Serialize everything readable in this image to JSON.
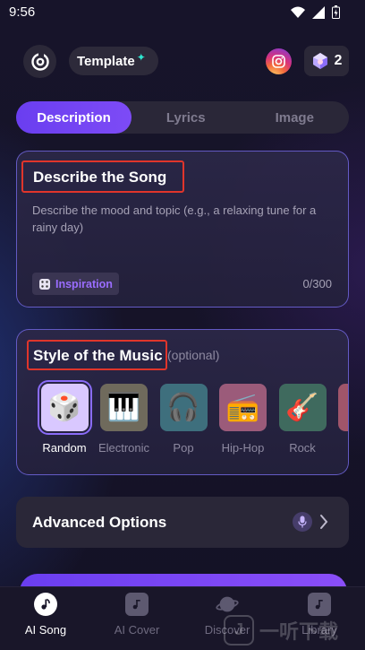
{
  "status_bar": {
    "time": "9:56"
  },
  "header": {
    "template_label": "Template",
    "template_star": "✦",
    "credits_count": "2"
  },
  "tabs": [
    {
      "label": "Description",
      "active": true
    },
    {
      "label": "Lyrics",
      "active": false
    },
    {
      "label": "Image",
      "active": false
    }
  ],
  "describe": {
    "title": "Describe the Song",
    "placeholder": "Describe the mood and topic (e.g., a relaxing tune for a rainy day)",
    "inspiration_label": "Inspiration",
    "counter": "0/300"
  },
  "style": {
    "title": "Style of the Music",
    "optional_label": "(optional)",
    "items": [
      {
        "label": "Random",
        "icon": "dice-icon",
        "glyph": "🎲",
        "bg": "#d9c8ff",
        "active": true
      },
      {
        "label": "Electronic",
        "icon": "synth-icon",
        "glyph": "🎹",
        "bg": "#6f6a5c",
        "active": false
      },
      {
        "label": "Pop",
        "icon": "headphones-icon",
        "glyph": "🎧",
        "bg": "#3e6f7d",
        "active": false
      },
      {
        "label": "Hip-Hop",
        "icon": "boombox-icon",
        "glyph": "📻",
        "bg": "#9b5b7a",
        "active": false
      },
      {
        "label": "Rock",
        "icon": "guitar-icon",
        "glyph": "🎸",
        "bg": "#3f6a5e",
        "active": false
      },
      {
        "label": "",
        "icon": "more-style-icon",
        "glyph": "",
        "bg": "#a0556a",
        "active": false
      }
    ]
  },
  "advanced": {
    "label": "Advanced Options"
  },
  "nav": [
    {
      "label": "AI Song",
      "icon": "music-note-icon",
      "active": true
    },
    {
      "label": "AI Cover",
      "icon": "music-file-icon",
      "active": false
    },
    {
      "label": "Discover",
      "icon": "planet-icon",
      "active": false
    },
    {
      "label": "Library",
      "icon": "library-icon",
      "active": false
    }
  ],
  "watermark": {
    "text": "一听下载"
  },
  "colors": {
    "accent": "#7048f3",
    "highlight_box": "#e0352b",
    "background": "#151226"
  }
}
